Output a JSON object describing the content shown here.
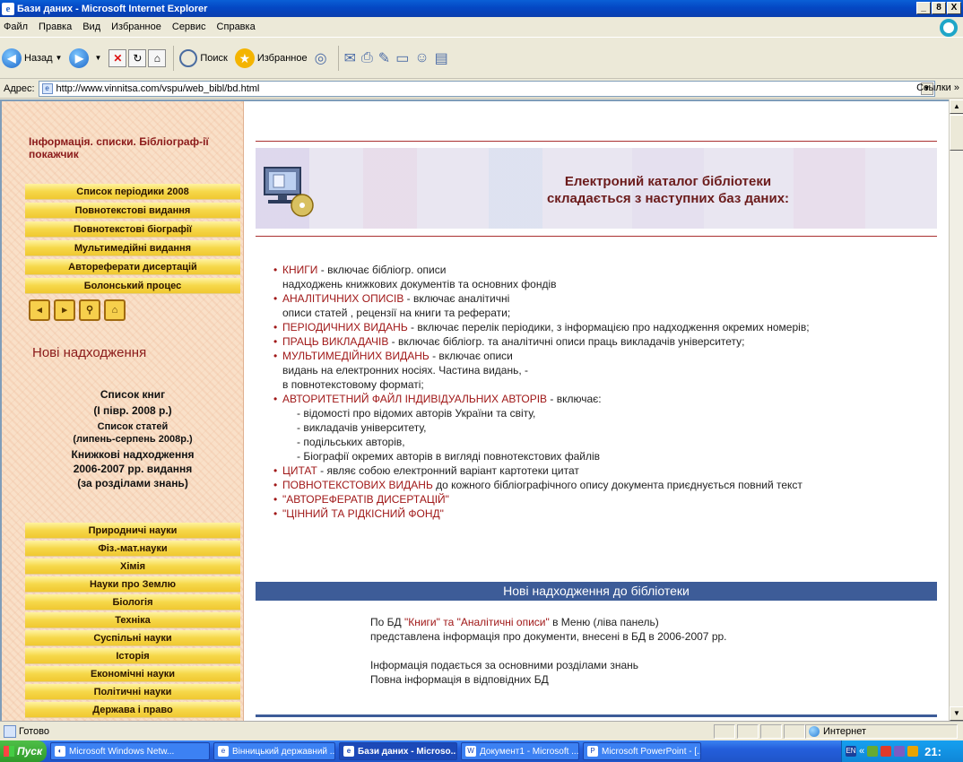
{
  "window": {
    "title": "Бази даних - Microsoft Internet Explorer",
    "controls": [
      "_",
      "8",
      "X"
    ]
  },
  "menu": [
    "Файл",
    "Правка",
    "Вид",
    "Избранное",
    "Сервис",
    "Справка"
  ],
  "toolbar": {
    "back_label": "Назад",
    "search_label": "Поиск",
    "favorites_label": "Избранное"
  },
  "address": {
    "label": "Адрес:",
    "url": "http://www.vinnitsa.com/vspu/web_bibl/bd.html",
    "links_label": "Ссылки"
  },
  "sidebar": {
    "intro": "Інформація. списки. Бібліограф-ії покажчик",
    "top_buttons": [
      "Список періодики 2008",
      "Повнотекстові видання",
      "Повнотекстові біографії",
      "Мультимедійні видання",
      "Автореферати дисертацій",
      "Болонський процес"
    ],
    "new_heading": "Нові надходження",
    "books_title": "Список книг",
    "books_period": "(І півр. 2008 р.)",
    "articles_title": "Список статей",
    "articles_period": "(липень-серпень 2008р.)",
    "book_arrivals_line1": "Книжкові надходження",
    "book_arrivals_line2": "2006-2007 рр. видання",
    "book_arrivals_line3": "(за розділами знань)",
    "subject_buttons": [
      "Природничі науки",
      "Фіз.-мат.науки",
      "Хімія",
      "Науки про Землю",
      "Біологія",
      "Техніка",
      "Суспільні науки",
      "Історія",
      "Економічні науки",
      "Політичні науки",
      "Держава і право"
    ]
  },
  "banner": {
    "line1": "Електроний каталог бібліотеки",
    "line2": "складається з наступних баз даних:"
  },
  "catalog": {
    "books_link": "КНИГИ",
    "books_text": " - включає бібліогр. описи",
    "books_cont": "надходжень книжкових документів та основних фондів",
    "analytic_link": "АНАЛІТИЧНИХ ОПИСІВ",
    "analytic_text": " - включає аналітичні",
    "analytic_cont": "описи статей , рецензії на книги та реферати;",
    "periodic_link": "ПЕРІОДИЧНИХ ВИДАНЬ",
    "periodic_text": " - включає перелік періодики, з інформацією про надходження окремих номерів;",
    "teachers_link": "ПРАЦЬ ВИКЛАДАЧІВ",
    "teachers_text": " - включає бібліогр. та аналітичні описи праць викладачів університету;",
    "multimedia_link": "МУЛЬТИМЕДІЙНИХ ВИДАНЬ",
    "multimedia_text": " - включає описи",
    "multimedia_cont1": "видань на електронних носіях. Частина видань, -",
    "multimedia_cont2": "в повнотекстовому форматі;",
    "authority_link": "АВТОРИТЕТНИЙ ФАЙЛ ІНДИВІДУАЛЬНИХ АВТОРІВ",
    "authority_text": " - включає:",
    "authority_subs": [
      "- відомості про відомих авторів України та світу,",
      "- викладачів університету,",
      "- подільських авторів,",
      "- Біографії окремих авторів в вигляді повнотекстових файлів"
    ],
    "quotes_link": "ЦИТАТ",
    "quotes_text": " - являє собою електронний варіант картотеки цитат",
    "fulltext_link": "ПОВНОТЕКСТОВИХ ВИДАНЬ",
    "fulltext_text": " до кожного бібліографічного опису документа приєднується повний текст",
    "abstracts_link": "\"АВТОРЕФЕРАТІВ ДИСЕРТАЦІЙ\"",
    "rare_link": "\"ЦІННИЙ ТА РІДКІСНИЙ ФОНД\""
  },
  "news": {
    "bar_title": "Нові надходження до бібліотеки",
    "line1_pre": "По БД ",
    "line1_link": "\"Книги\" та \"Аналітичні описи\"",
    "line1_post": " в Меню (ліва панель)",
    "line2": "представлена інформація про документи, внесені в БД в 2006-2007 рр.",
    "line3": "Інформація подається за основними розділами знань",
    "line4": "Повна інформація в відповідних БД"
  },
  "status": {
    "text": "Готово",
    "zone": "Интернет"
  },
  "taskbar": {
    "start": "Пуск",
    "tasks": [
      "Microsoft Windows Netw...",
      "Вінницький державний ...",
      "Бази даних - Microso...",
      "Документ1 - Microsoft ...",
      "Microsoft PowerPoint - [..."
    ],
    "clock": "21:",
    "lang": "EN"
  }
}
